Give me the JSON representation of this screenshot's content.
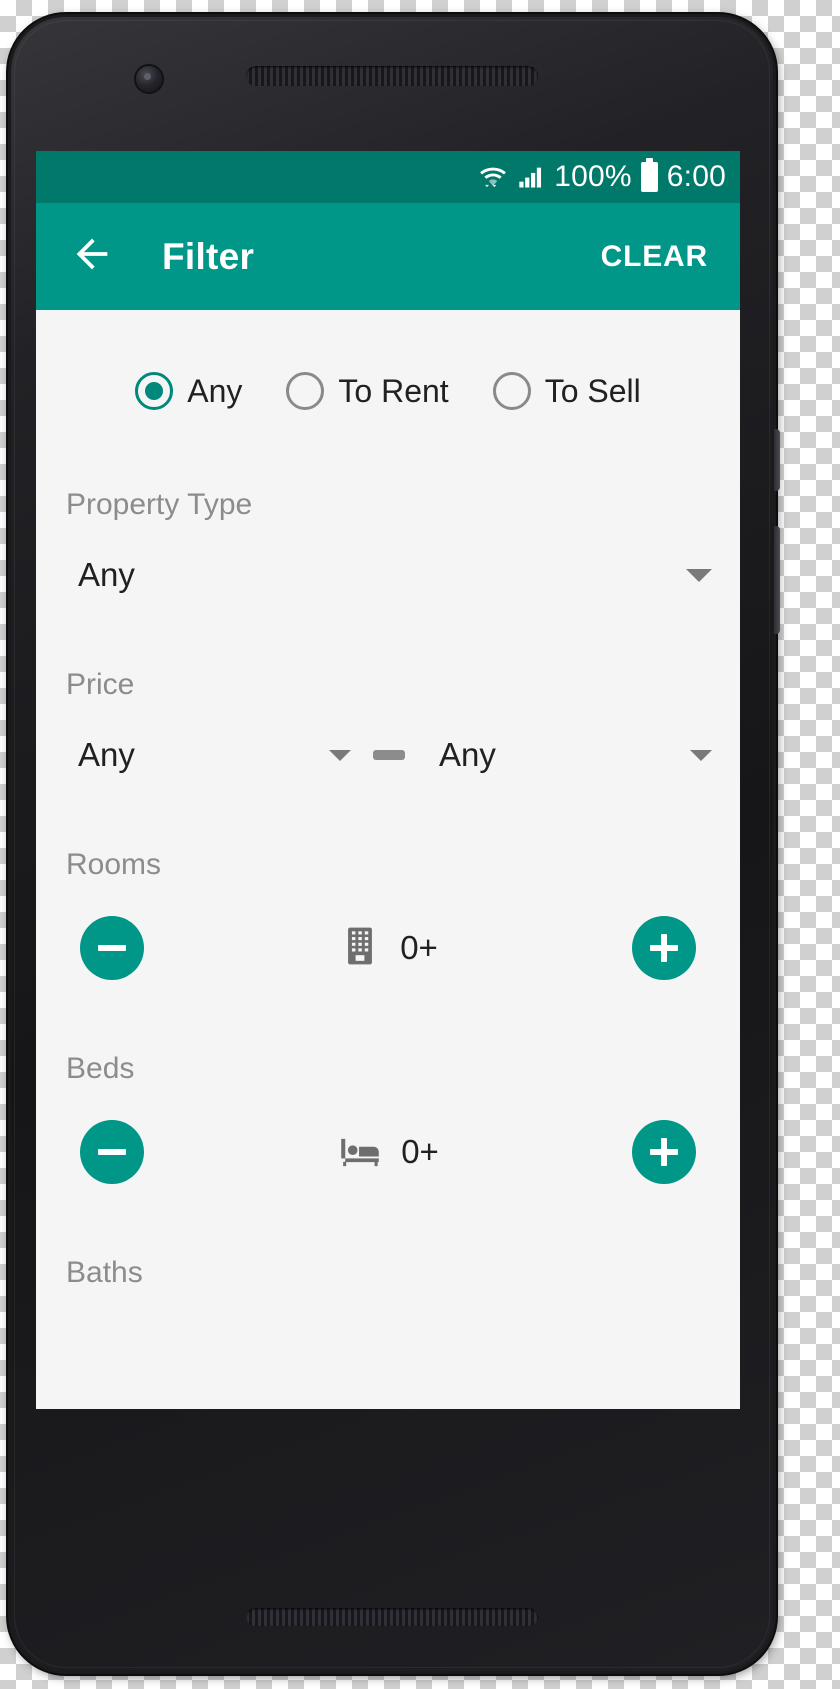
{
  "device": {
    "frame_color": "#1b1b1d",
    "camera": "front-camera",
    "earpiece": "earpiece-speaker"
  },
  "statusbar": {
    "background": "#00796b",
    "wifi_icon": "wifi-icon",
    "signal_icon": "cellular-signal-icon",
    "battery_percent": "100%",
    "battery_icon": "battery-full-icon",
    "time": "6:00"
  },
  "appbar": {
    "background": "#009688",
    "back_icon": "arrow-back-icon",
    "title": "Filter",
    "clear_label": "CLEAR"
  },
  "filter": {
    "listing_type": {
      "selected": "Any",
      "options": [
        {
          "label": "Any",
          "checked": true
        },
        {
          "label": "To Rent",
          "checked": false
        },
        {
          "label": "To Sell",
          "checked": false
        }
      ]
    },
    "property_type": {
      "label": "Property Type",
      "value": "Any",
      "caret_icon": "chevron-down-icon"
    },
    "price": {
      "label": "Price",
      "min_value": "Any",
      "max_value": "Any",
      "separator": "dash",
      "caret_icon": "chevron-down-icon"
    },
    "rooms": {
      "label": "Rooms",
      "icon": "apartment-building-icon",
      "count": "0+",
      "decrement_icon": "minus-icon",
      "increment_icon": "plus-icon"
    },
    "beds": {
      "label": "Beds",
      "icon": "bed-icon",
      "count": "0+",
      "decrement_icon": "minus-icon",
      "increment_icon": "plus-icon"
    },
    "baths": {
      "label": "Baths"
    }
  },
  "colors": {
    "primary": "#009688",
    "primary_dark": "#00796b",
    "accent": "#00897b",
    "surface": "#f5f5f5",
    "text_primary": "#212121",
    "text_secondary": "#8c8c8c"
  }
}
